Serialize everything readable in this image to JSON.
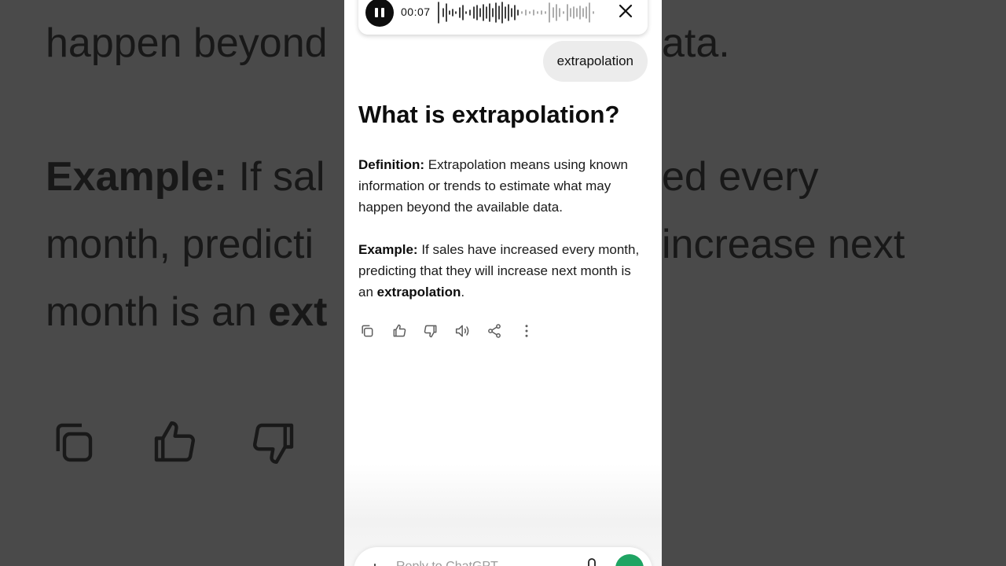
{
  "background": {
    "line1_left": "happen beyond",
    "line1_right": "ata.",
    "line2_left_bold": "Example:",
    "line2_left": " If sal",
    "line2_right": "ed every",
    "line3_left": "month, predicti",
    "line3_right": "increase next",
    "line4_left": "month is an ",
    "line4_left_bold": "ext"
  },
  "voice_bar": {
    "timer": "00:07",
    "pause_icon": "pause-icon",
    "close_icon": "close-icon"
  },
  "user_message": "extrapolation",
  "response": {
    "title": "What is extrapolation?",
    "definition_label": "Definition:",
    "definition_text": " Extrapolation means using known information or trends to estimate what may happen beyond the available data.",
    "example_label": "Example:",
    "example_text": " If sales have increased every month, predicting that they will increase next month is an ",
    "example_bold": "extrapolation",
    "example_end": "."
  },
  "actions": [
    "copy-icon",
    "thumbs-up-icon",
    "thumbs-down-icon",
    "read-aloud-icon",
    "share-icon",
    "more-icon"
  ],
  "composer": {
    "plus": "+",
    "placeholder": "Reply to ChatGPT"
  },
  "colors": {
    "background_dim": "#4a4a4a",
    "send_button": "#1fa463",
    "bubble": "#ececec"
  }
}
